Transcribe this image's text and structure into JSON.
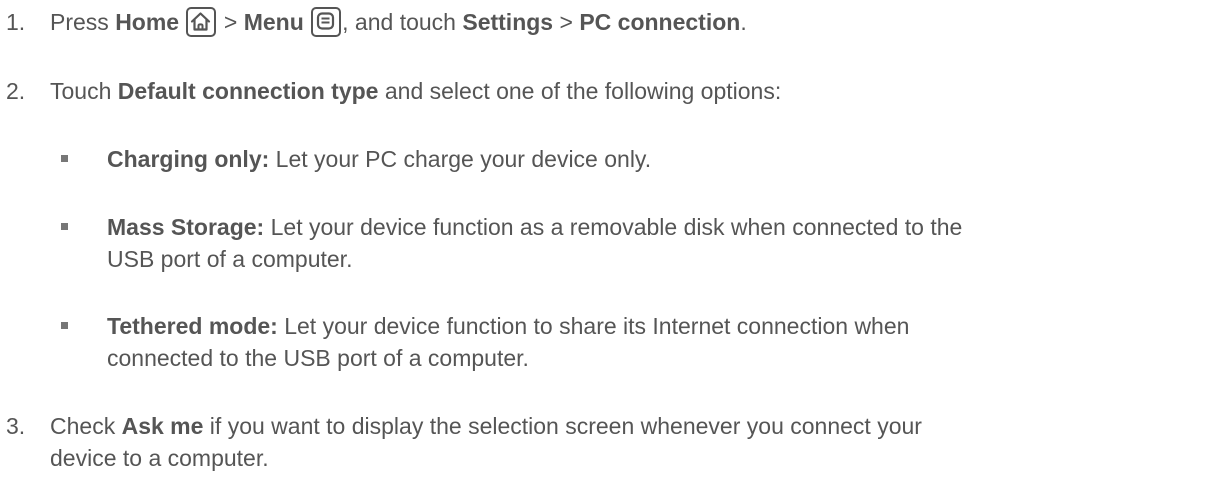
{
  "steps": [
    {
      "number": "1.",
      "parts": {
        "press": "Press ",
        "home": "Home",
        "gt1": " > ",
        "menu": "Menu",
        "and_touch": ", and touch ",
        "settings": "Settings",
        "gt2": " > ",
        "pc_connection": "PC connection",
        "end": "."
      },
      "icons": [
        "home-icon",
        "menu-icon"
      ]
    },
    {
      "number": "2.",
      "parts": {
        "touch": "Touch ",
        "default_connection_type": "Default connection type",
        "rest": " and select one of the following options:"
      }
    },
    {
      "number": "3.",
      "parts": {
        "check": "Check ",
        "ask_me": "Ask me",
        "line1_rest": " if you want to display the selection screen whenever you connect your",
        "line2": "device to a computer."
      }
    }
  ],
  "options": [
    {
      "term": "Charging only:",
      "line1": " Let your PC charge your device only."
    },
    {
      "term": "Mass Storage:",
      "line1": " Let your device function as a removable disk when connected to the",
      "line2": "USB port of a computer."
    },
    {
      "term": "Tethered mode:",
      "line1": " Let your device function to share its Internet connection when",
      "line2": "connected to the USB port of a computer."
    }
  ]
}
